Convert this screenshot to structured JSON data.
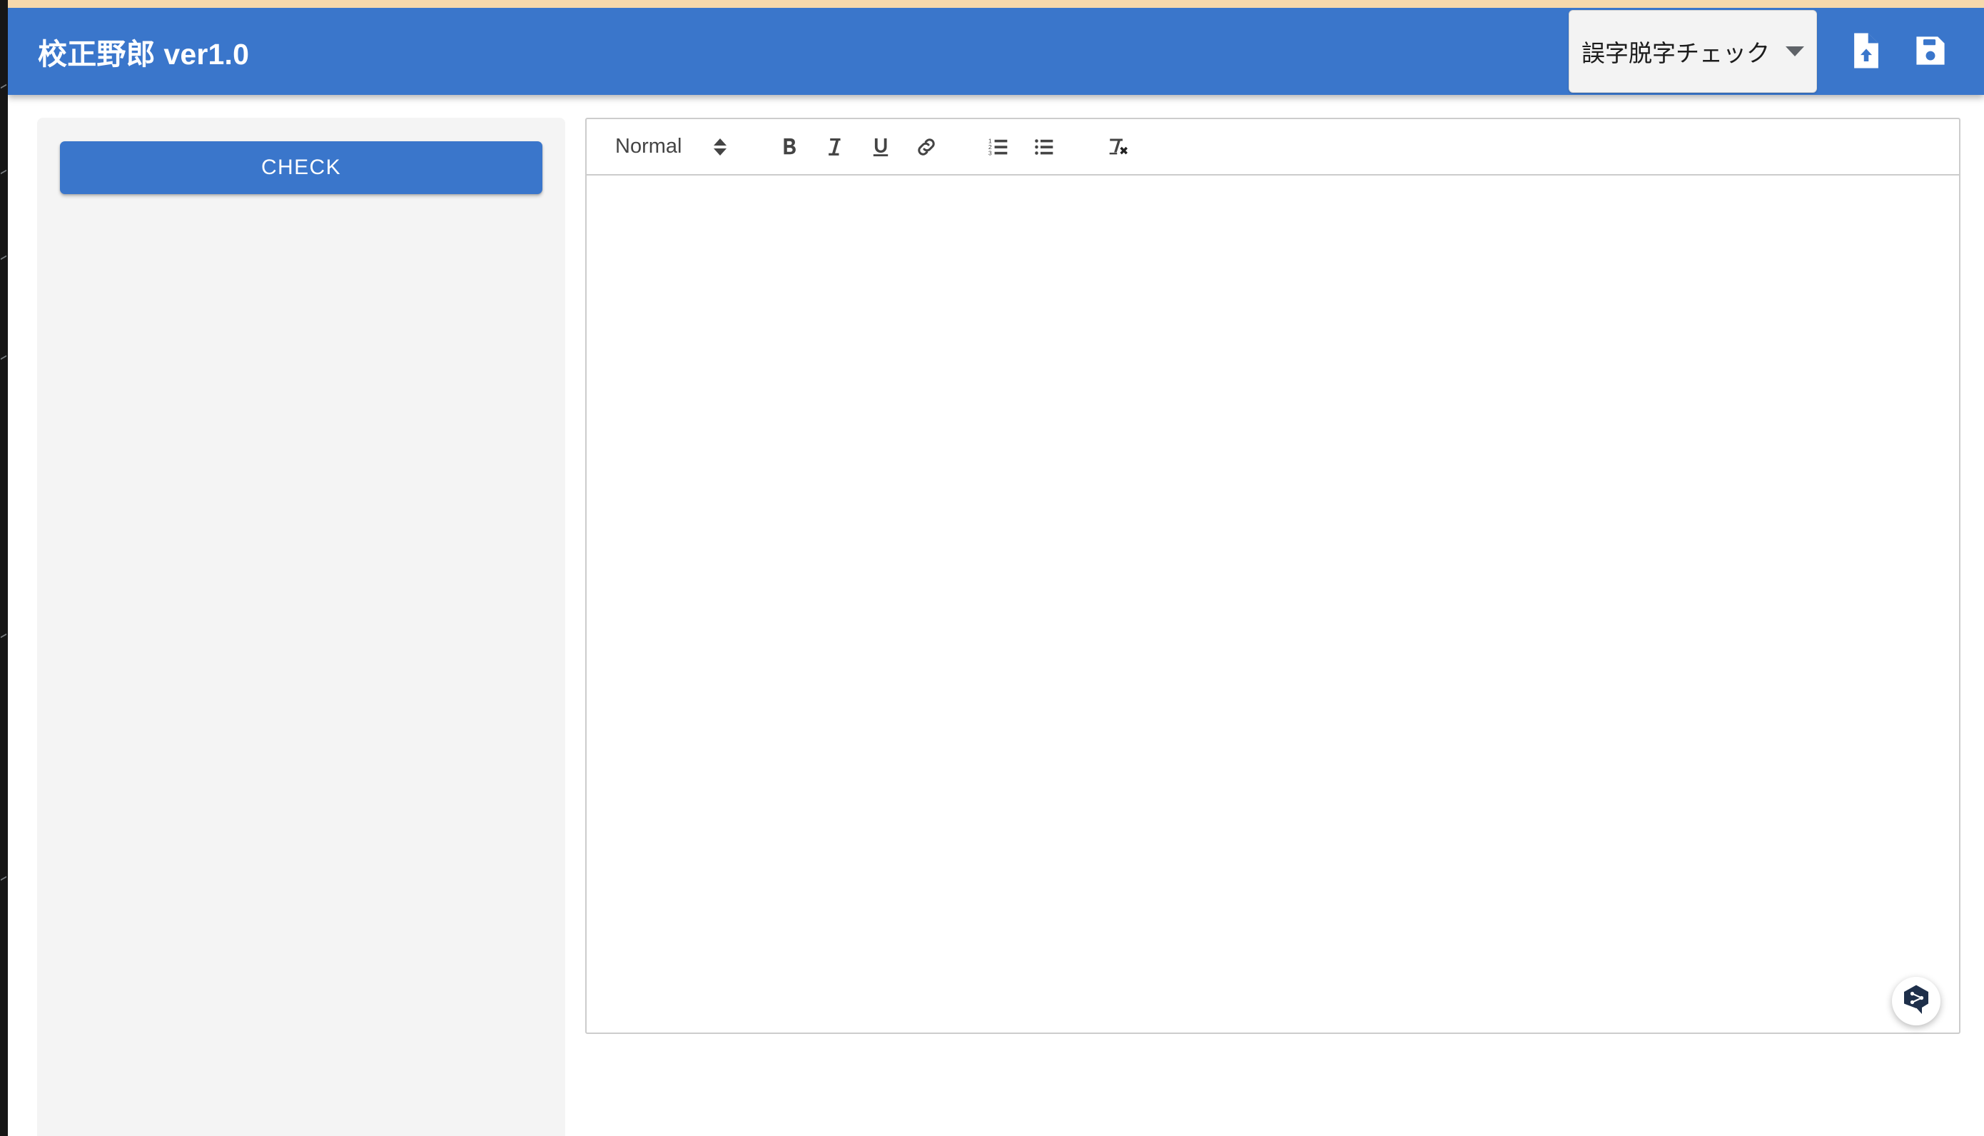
{
  "app": {
    "title": "校正野郎 ver1.0",
    "header_bg": "#3a76cb",
    "accent": "#3a76cb"
  },
  "header": {
    "mode_select": {
      "name": "mode-select",
      "selected": "誤字脱字チェック",
      "caret_icon": "chevron-down-icon"
    },
    "actions": [
      {
        "name": "file-upload-button",
        "icon": "file-upload-icon",
        "label": ""
      },
      {
        "name": "save-button",
        "icon": "save-icon",
        "label": ""
      }
    ]
  },
  "sidebar": {
    "check_button": {
      "label": "CHECK",
      "bg": "#3a76cb",
      "text_color": "#ffffff"
    },
    "bg": "#f4f4f4"
  },
  "editor": {
    "toolbar": {
      "header_picker": {
        "value": "Normal",
        "icon": "updown-arrows-icon"
      },
      "buttons": [
        {
          "name": "bold-button",
          "icon": "bold-icon",
          "label": "B"
        },
        {
          "name": "italic-button",
          "icon": "italic-icon",
          "label": "I"
        },
        {
          "name": "underline-button",
          "icon": "underline-icon",
          "label": "U"
        },
        {
          "name": "link-button",
          "icon": "link-icon",
          "label": ""
        },
        {
          "name": "ordered-list-button",
          "icon": "ordered-list-icon",
          "label": ""
        },
        {
          "name": "bullet-list-button",
          "icon": "bullet-list-icon",
          "label": ""
        },
        {
          "name": "clear-format-button",
          "icon": "clear-format-icon",
          "label": "Tx"
        }
      ]
    },
    "content": "",
    "caret_visible": true,
    "border_color": "#cccccc"
  },
  "floating_widget": {
    "name": "helper-widget-button",
    "icon": "node-graph-hexagon-icon",
    "color": "#1e2f4a"
  }
}
